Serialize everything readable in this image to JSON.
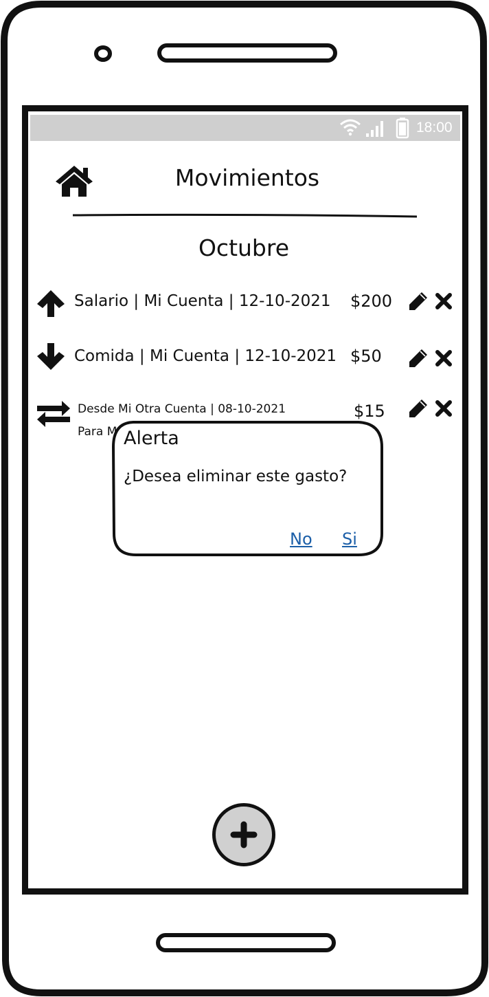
{
  "status_bar": {
    "time": "18:00"
  },
  "header": {
    "title": "Movimientos"
  },
  "section": {
    "month": "Octubre"
  },
  "movements": [
    {
      "type": "income",
      "description": "Salario | Mi Cuenta | 12-10-2021",
      "amount": "$200"
    },
    {
      "type": "expense",
      "description": "Comida | Mi Cuenta | 12-10-2021",
      "amount": "$50"
    },
    {
      "type": "transfer",
      "from_line": "Desde Mi Otra Cuenta | 08-10-2021",
      "to_line_visible": "Para M",
      "amount": "$15"
    }
  ],
  "dialog": {
    "title": "Alerta",
    "message": "¿Desea eliminar este gasto?",
    "no_label": "No",
    "yes_label": "Si"
  },
  "icons": {
    "home": "home-icon",
    "income": "arrow-up-icon",
    "expense": "arrow-down-icon",
    "transfer": "transfer-icon",
    "edit": "pencil-icon",
    "delete": "close-icon",
    "add": "plus-icon"
  },
  "colors": {
    "status_bar": "#cfcfcf",
    "link": "#1c5fa8",
    "fab": "#d0d0d0"
  }
}
